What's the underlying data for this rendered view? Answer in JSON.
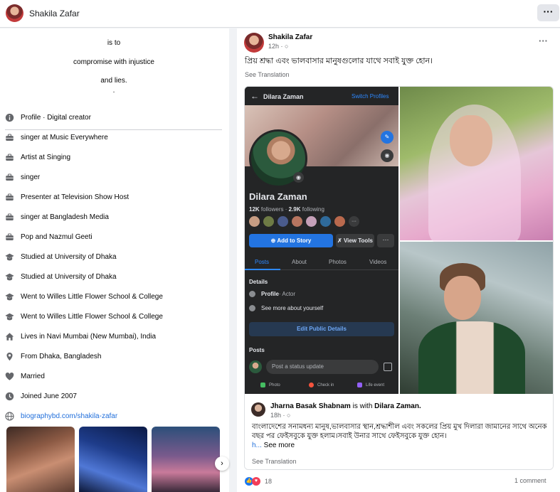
{
  "header": {
    "name": "Shakila Zafar",
    "more_label": "···"
  },
  "intro": {
    "bio": [
      "is to",
      "compromise with injustice",
      "and lies.",
      "."
    ],
    "items": [
      {
        "icon": "info-icon",
        "text": "Profile · Digital creator"
      },
      {
        "icon": "briefcase-icon",
        "text": "singer at Music Everywhere"
      },
      {
        "icon": "briefcase-icon",
        "text": "Artist at Singing"
      },
      {
        "icon": "briefcase-icon",
        "text": "singer"
      },
      {
        "icon": "briefcase-icon",
        "text": "Presenter at Television Show Host"
      },
      {
        "icon": "briefcase-icon",
        "text": "singer at Bangladesh Media"
      },
      {
        "icon": "briefcase-icon",
        "text": "Pop and Nazmul Geeti"
      },
      {
        "icon": "graduation-cap-icon",
        "text": "Studied at University of Dhaka"
      },
      {
        "icon": "graduation-cap-icon",
        "text": "Studied at University of Dhaka"
      },
      {
        "icon": "graduation-cap-icon",
        "text": "Went to Willes Little Flower School & College"
      },
      {
        "icon": "graduation-cap-icon",
        "text": "Went to Willes Little Flower School & College"
      },
      {
        "icon": "home-icon",
        "text": "Lives in Navi Mumbai (New Mumbai), India"
      },
      {
        "icon": "location-pin-icon",
        "text": "From Dhaka, Bangladesh"
      },
      {
        "icon": "heart-icon",
        "text": "Married"
      },
      {
        "icon": "clock-icon",
        "text": "Joined June 2007"
      },
      {
        "icon": "globe-icon",
        "text": "biographybd.com/shakila-zafar"
      }
    ],
    "photos_next_label": "›"
  },
  "post": {
    "author": "Shakila Zafar",
    "time": "12h · ",
    "more_label": "···",
    "text": "প্রিয় শ্রদ্ধা এবং ভালবাসার মানুষগুলোর যাথে সবাই যুক্ত হোন।",
    "see_translation": "See Translation",
    "phone": {
      "back": "←",
      "title": "Dilara Zaman",
      "switch": "Switch Profiles",
      "name": "Dilara Zaman",
      "followers_count": "12K",
      "followers_label": "followers",
      "following_count": "2.9K",
      "following_label": "following",
      "add_story": "Add to Story",
      "view_tools": "View Tools",
      "more": "···",
      "tabs": [
        "Posts",
        "About",
        "Photos",
        "Videos"
      ],
      "details_heading": "Details",
      "profile_label": "Profile",
      "profile_role": " · Actor",
      "see_more_about": "See more about yourself",
      "edit_public": "Edit Public Details",
      "posts_heading": "Posts",
      "status_placeholder": "Post a status update",
      "actions": [
        "Photo",
        "Check in",
        "Life event"
      ]
    },
    "shared": {
      "author": "Jharna Basak Shabnam",
      "with_word": " is with ",
      "with_name": "Dilara Zaman.",
      "time": "18h · ",
      "body": "বাংলাদেশের সনামধন্য মানুষ,ভালবাসার স্থান,শ্রদ্ধাশীল এবং সকলের প্রিয় মুখ দিলারা জামানের সাথে অনেক বছর পর ফেইসবুকে যুক্ত হলাম।সবাই উনার সাথে ফেইসবুকে যুক্ত হোন।",
      "ellipsis": "h...",
      "see_more": " See more",
      "see_translation": "See Translation"
    },
    "reaction_count": "18",
    "comments": "1 comment"
  },
  "colors": {
    "accent": "#1877f2",
    "link": "#216fdb",
    "phone_bg": "#242526"
  }
}
